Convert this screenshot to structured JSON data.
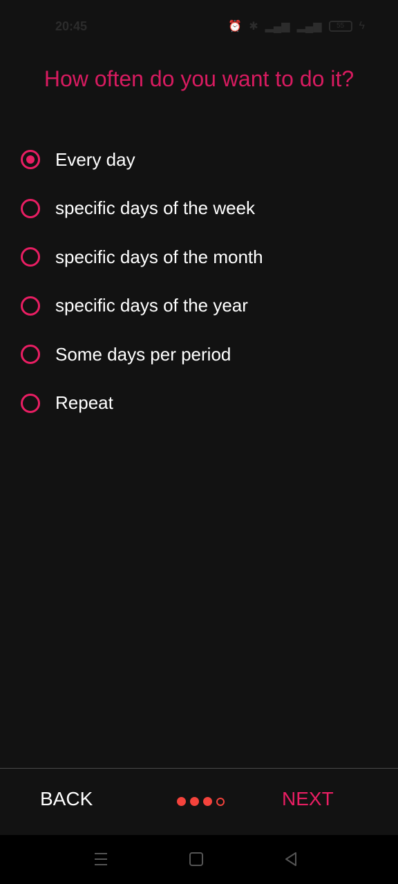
{
  "status_bar": {
    "time": "20:45",
    "battery": "55",
    "icons": [
      "alarm-icon",
      "bluetooth-icon",
      "signal-icon",
      "signal-4g-icon",
      "battery-icon",
      "charging-icon"
    ]
  },
  "title": "How often do  you want to do it?",
  "options": [
    {
      "label": "Every day",
      "checked": true
    },
    {
      "label": "specific days of the week",
      "checked": false
    },
    {
      "label": "specific days of the month",
      "checked": false
    },
    {
      "label": "specific days of the year",
      "checked": false
    },
    {
      "label": "Some days per period",
      "checked": false
    },
    {
      "label": "Repeat",
      "checked": false
    }
  ],
  "bottom_bar": {
    "back_label": "BACK",
    "next_label": "NEXT",
    "progress": {
      "current_step": 3,
      "total_steps": 4
    }
  },
  "colors": {
    "accent": "#e91e63",
    "dots": "#f4433c",
    "background": "#121212"
  },
  "nav_bar": {
    "icons": [
      "menu-icon",
      "home-icon",
      "back-icon"
    ]
  }
}
